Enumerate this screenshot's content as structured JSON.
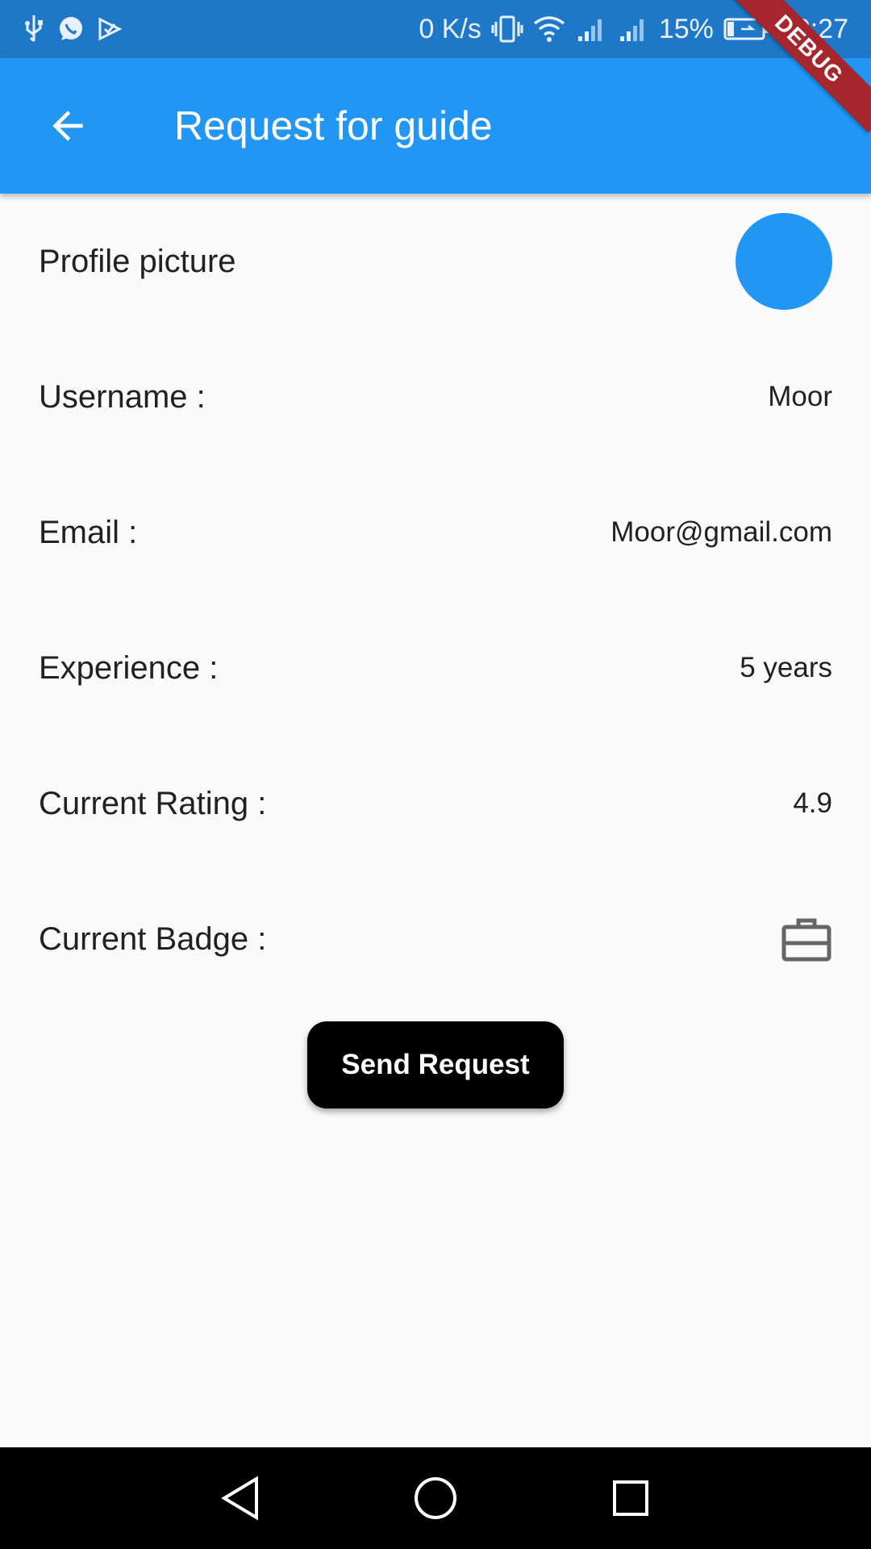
{
  "status_bar": {
    "speed": "0 K/s",
    "battery": "15%",
    "time": "00:27",
    "icons": [
      "usb-icon",
      "whatsapp-icon",
      "play-store-icon",
      "vibrate-icon",
      "wifi-icon",
      "signal-icon",
      "signal-icon",
      "battery-charging-icon"
    ]
  },
  "debug_banner": "DEBUG",
  "app_bar": {
    "title": "Request for guide",
    "back_icon": "arrow-back-icon",
    "color": "#2196f3"
  },
  "profile": {
    "picture_label": "Profile picture",
    "avatar_color": "#2196f3",
    "username_label": "Username :",
    "username_value": "Moor",
    "email_label": "Email :",
    "email_value": "Moor@gmail.com",
    "experience_label": "Experience :",
    "experience_value": "5 years",
    "rating_label": "Current Rating :",
    "rating_value": "4.9",
    "badge_label": "Current Badge :",
    "badge_icon": "briefcase-icon"
  },
  "actions": {
    "send_request_label": "Send Request"
  },
  "nav_bar": {
    "icons": [
      "nav-back-icon",
      "nav-home-icon",
      "nav-recents-icon"
    ]
  }
}
